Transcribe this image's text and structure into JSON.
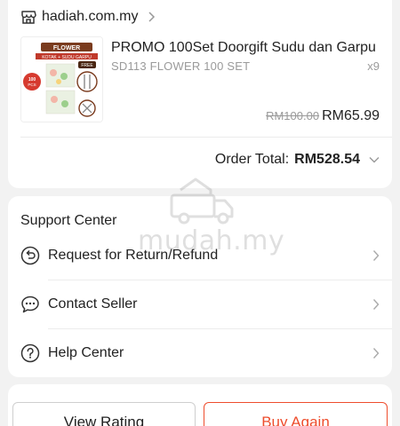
{
  "order": {
    "shop_name": "hadiah.com.my",
    "product": {
      "name": "PROMO 100Set Doorgift Sudu dan Garpu",
      "variant": "SD113 FLOWER 100 SET",
      "quantity": "x9",
      "price_original": "RM100.00",
      "price_current": "RM65.99",
      "thumbnail": {
        "header": "FLOWER",
        "subheader": "KOTAK + SUDU GARPU",
        "free_tag": "FREE",
        "badge_line1": "100",
        "badge_line2": "PCS"
      }
    },
    "total_label": "Order Total:",
    "total_value": "RM528.54"
  },
  "support": {
    "title": "Support Center",
    "items": [
      {
        "label": "Request for Return/Refund",
        "icon": "return-icon"
      },
      {
        "label": "Contact Seller",
        "icon": "chat-icon"
      },
      {
        "label": "Help Center",
        "icon": "help-icon"
      }
    ]
  },
  "actions": {
    "view_rating": "View Rating",
    "buy_again": "Buy Again"
  },
  "watermark": "mudah.my",
  "colors": {
    "accent": "#ee4d2d",
    "muted_text": "#9a9a9a",
    "background": "#f2f2f2"
  }
}
